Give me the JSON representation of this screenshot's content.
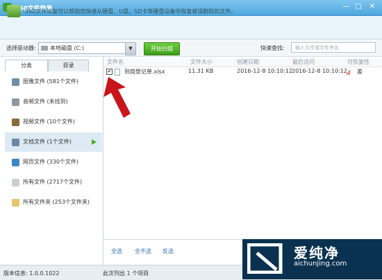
{
  "window": {
    "title": "360文件恢复",
    "controls": [
      "—",
      "□",
      "✕"
    ]
  },
  "banner": {
    "text": "360文件恢复可以帮助您快速从硬盘、U盘、SD卡等硬盘设备中恢复被误删除的文件。"
  },
  "toolbar": {
    "drive_label": "选择驱动器:",
    "drive_value": "本地磁盘 (C:)",
    "scan_label": "开始扫描",
    "quick_label": "快速查找:",
    "search_placeholder": "输入文件或文件夹名"
  },
  "tabs": [
    "分类",
    "目录"
  ],
  "categories": [
    {
      "label": "图像文件 (581个文件)",
      "icon": "image-icon",
      "color": "#6d8ea8"
    },
    {
      "label": "音频文件 (未找到)",
      "icon": "music-icon",
      "color": "#8c99a3"
    },
    {
      "label": "视频文件 (10个文件)",
      "icon": "video-icon",
      "color": "#8a6a3b"
    },
    {
      "label": "文档文件 (1个文件)",
      "icon": "document-icon",
      "color": "#6c8aa6"
    },
    {
      "label": "网页文件 (330个文件)",
      "icon": "webpage-icon",
      "color": "#3f86c8"
    },
    {
      "label": "所有文件 (2717个文件)",
      "icon": "file-icon",
      "color": "#c7cfd6"
    },
    {
      "label": "所有文件夹 (253个文件夹)",
      "icon": "folder-icon",
      "color": "#e8c46a"
    }
  ],
  "table": {
    "headers": [
      "文件名",
      "文件大小",
      "创建日期",
      "最后访问",
      "可恢复性"
    ],
    "rows": [
      {
        "name": "到岗登记单.xlsx",
        "size": "11.31 KB",
        "created": "2016-12-8 10:10:12",
        "accessed": "2016-12-8 10:10:12",
        "recover": "差"
      }
    ]
  },
  "footer": {
    "select_all": "全选",
    "select_none": "全不选",
    "invert": "反选"
  },
  "status": {
    "version": "版本信息: 1.0.0.1022",
    "count": "此次列出 1 个项目"
  },
  "watermark": {
    "cn": "爱纯净",
    "url": "aichunjing.com"
  },
  "colors": {
    "accent_green": "#3c9c1a",
    "title_blue": "#4fa7de",
    "arrow_red": "#c8141b"
  }
}
